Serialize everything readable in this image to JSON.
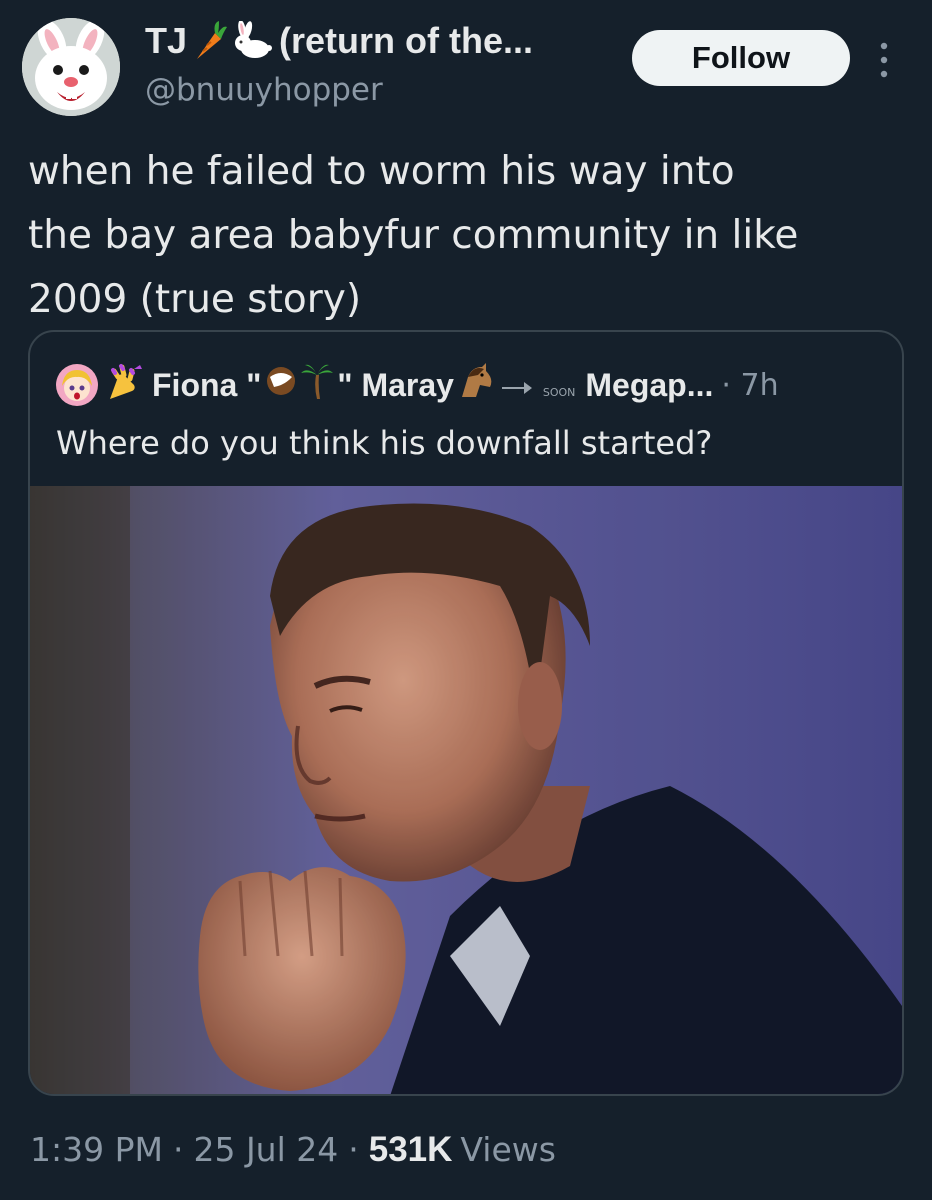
{
  "author": {
    "display_name": "TJ",
    "display_name_suffix": "(return of the...",
    "handle": "@bnuuyhopper",
    "name_emojis": [
      "carrot-emoji",
      "rabbit-emoji"
    ]
  },
  "follow_button_label": "Follow",
  "tweet": {
    "lines": [
      "when he failed to worm his way into",
      "the bay area babyfur community in like",
      "2009 (true story)"
    ]
  },
  "quote": {
    "name_part1": "Fiona \"",
    "name_part2": "\" Maray",
    "name_part3": "Megap...",
    "soon_badge": "SOON",
    "separator": "·",
    "time": "7h",
    "text": "Where do you think his downfall started?"
  },
  "meta": {
    "time": "1:39 PM",
    "date": "25 Jul 24",
    "views_count": "531K",
    "views_label": "Views",
    "separator": "·"
  },
  "colors": {
    "background": "#15202b",
    "text_primary": "#e7e9ea",
    "text_secondary": "#8b98a5",
    "border": "#38444d",
    "button_bg": "#eff3f4"
  }
}
